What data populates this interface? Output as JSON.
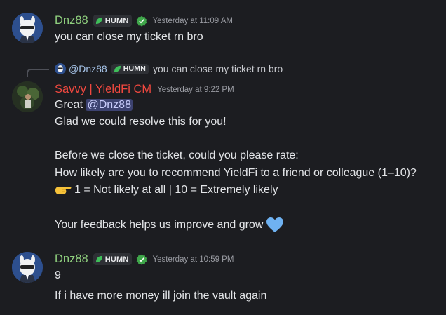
{
  "messages": [
    {
      "author": "Dnz88",
      "tag": "HUMN",
      "timestamp": "Yesterday at 11:09 AM",
      "lines": [
        "you can close my ticket rn bro"
      ]
    },
    {
      "reply": {
        "author": "@Dnz88",
        "tag": "HUMN",
        "text": "you can close my ticket rn bro"
      },
      "author": "Savvy | YieldFi CM",
      "timestamp": "Yesterday at 9:22 PM",
      "line1_prefix": "Great ",
      "mention": "@Dnz88",
      "lines": [
        "Glad we could resolve this for you!",
        "Before we close the ticket, could you please rate:",
        "How likely are you to recommend YieldFi to a friend or colleague (1–10)?",
        "1 = Not likely at all | 10 = Extremely likely",
        "Your feedback helps us improve and grow"
      ]
    },
    {
      "author": "Dnz88",
      "tag": "HUMN",
      "timestamp": "Yesterday at 10:59 PM",
      "lines": [
        "9",
        "If i have more money ill join the vault again"
      ]
    }
  ],
  "icons": {
    "tag_leaf": "leaf-icon",
    "verified": "verified-badge-icon",
    "pointing": "pointing-hand-icon",
    "heart": "blue-heart-icon"
  },
  "colors": {
    "background": "#1c1d21",
    "dnz_name": "#8fcf7e",
    "savvy_name": "#f0483f",
    "mention_bg": "#3c4270",
    "heart": "#6fb2f2"
  }
}
